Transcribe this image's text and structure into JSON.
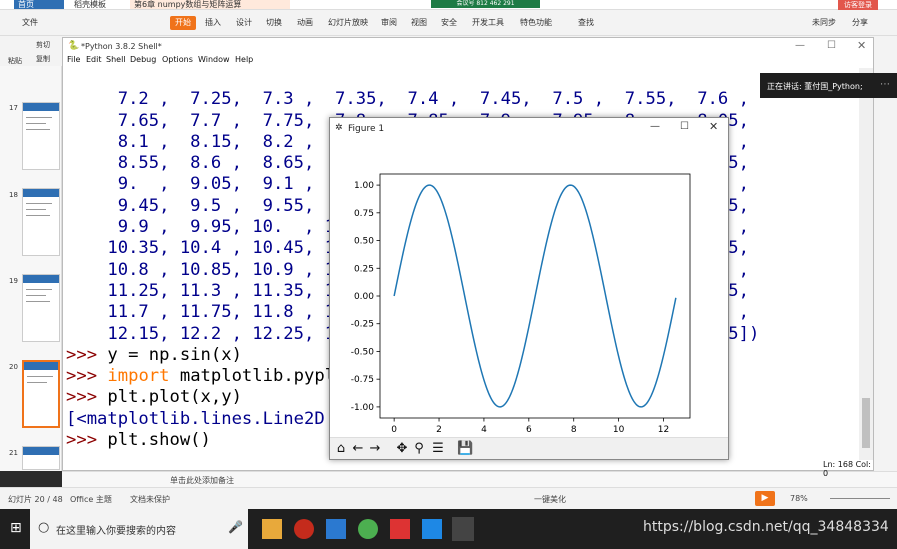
{
  "wps": {
    "tabs": [
      "首页",
      "稻壳模板",
      "第6章 numpy数组与矩阵运算"
    ],
    "menus": [
      "文件",
      "开始",
      "插入",
      "设计",
      "切换",
      "动画",
      "幻灯片放映",
      "审阅",
      "视图",
      "安全",
      "开发工具",
      "特色功能",
      "查找"
    ],
    "right_menu": [
      "未同步",
      "分享"
    ],
    "toolbar_labels": [
      "粘贴",
      "剪切",
      "复制"
    ],
    "login": "访客登录",
    "slide_numbers": [
      "17",
      "18",
      "19",
      "20",
      "21"
    ],
    "notes_placeholder": "单击此处添加备注",
    "status_slide": "幻灯片 20 / 48",
    "status_theme": "Office 主题",
    "status_protect": "文档未保护",
    "status_beautify": "一键美化",
    "zoom": "78%",
    "meeting_banner": "会议号 812 462 291",
    "speaker": "正在讲话: 董付国_Python;"
  },
  "shell": {
    "title": "*Python 3.8.2 Shell*",
    "menus": [
      "File",
      "Edit",
      "Shell",
      "Debug",
      "Options",
      "Window",
      "Help"
    ],
    "ln_col": "Ln: 168  Col: 0",
    "lines": [
      "     7.2 ,  7.25,  7.3 ,  7.35,  7.4 ,  7.45,  7.5 ,  7.55,  7.6 ,",
      "     7.65,  7.7 ,  7.75,  7.8 ,  7.85,  7.9 ,  7.95,  8.  ,  8.05,",
      "     8.1 ,  8.15,  8.2 ,  8.25,  8.3 ,  8.35,  8.4 ,  8.45,  8.5 ,",
      "     8.55,  8.6 ,  8.65,  8.7 ,  8.75,  8.8 ,  8.85,  8.9 ,  8.95,",
      "     9.  ,  9.05,  9.1 ,  9.15,  9.2 ,  9.25,  9.3 ,  9.35,  9.4 ,",
      "     9.45,  9.5 ,  9.55,  9.6 ,  9.65,  9.7 ,  9.75,  9.8 ,  9.85,",
      "     9.9 ,  9.95, 10.  , 10.05, 10.1 , 10.15, 10.2 , 10.25, 10.3 ,",
      "    10.35, 10.4 , 10.45, 10.5 , 10.55, 10.6 , 10.65, 10.7 , 10.75,",
      "    10.8 , 10.85, 10.9 , 10.95, 11.  , 11.05, 11.1 , 11.15, 11.2 ,",
      "    11.25, 11.3 , 11.35, 11.4 , 11.45, 11.5 , 11.55, 11.6 , 11.65,",
      "    11.7 , 11.75, 11.8 , 11.85, 11.9 , 11.95, 12.  , 12.05, 12.1 ,",
      "    12.15, 12.2 , 12.25, 12.3 , 12.35, 12.4 , 12.45, 12.5 , 12.55])"
    ],
    "prompts": [
      ">>> y = np.sin(x)",
      ">>> import matplotlib.pyplot as plt",
      ">>> plt.plot(x,y)",
      "[<matplotlib.lines.Line2D object at 0x...>]",
      ">>> plt.show()"
    ]
  },
  "figure": {
    "title": "Figure 1",
    "line_color": "#1f77b4"
  },
  "chart_data": {
    "type": "line",
    "x_range": [
      0,
      12.55
    ],
    "xticks": [
      "0",
      "2",
      "4",
      "6",
      "8",
      "10",
      "12"
    ],
    "yticks": [
      "1.00",
      "0.75",
      "0.50",
      "0.25",
      "0.00",
      "-0.25",
      "-0.50",
      "-0.75",
      "-1.00"
    ],
    "xlim": [
      -0.63,
      13.18
    ],
    "ylim": [
      -1.1,
      1.1
    ],
    "function": "sin",
    "x_step": 0.05,
    "series": [
      {
        "color": "#1f77b4"
      }
    ]
  },
  "taskbar": {
    "search_placeholder": "在这里输入你要搜索的内容",
    "watermark": "https://blog.csdn.net/qq_34848334"
  }
}
